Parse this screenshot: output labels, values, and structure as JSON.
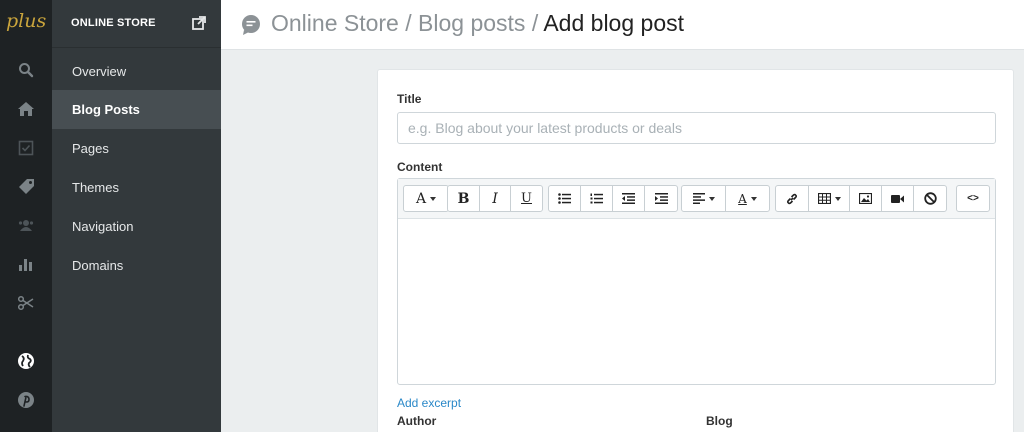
{
  "app": {
    "logo_text": "plus",
    "brand_color": "#c9a43c"
  },
  "rail": {
    "icons": [
      "search-icon",
      "home-icon",
      "orders-icon",
      "tag-icon",
      "customers-icon",
      "reports-icon",
      "discounts-icon",
      "globe-icon",
      "pinterest-icon"
    ]
  },
  "subnav": {
    "title": "ONLINE STORE",
    "items": [
      {
        "label": "Overview",
        "active": false
      },
      {
        "label": "Blog Posts",
        "active": true
      },
      {
        "label": "Pages",
        "active": false
      },
      {
        "label": "Themes",
        "active": false
      },
      {
        "label": "Navigation",
        "active": false
      },
      {
        "label": "Domains",
        "active": false
      }
    ]
  },
  "breadcrumb": {
    "part1": "Online Store",
    "sep1": " / ",
    "part2": "Blog posts",
    "sep2": " / ",
    "current": "Add blog post"
  },
  "form": {
    "title_label": "Title",
    "title_value": "",
    "title_placeholder": "e.g. Blog about your latest products or deals",
    "content_label": "Content",
    "toolbar": {
      "font_glyph": "A",
      "bold_glyph": "B",
      "italic_glyph": "I",
      "underline_glyph": "U",
      "color_glyph": "A",
      "code_glyph": "<>"
    },
    "add_excerpt": "Add excerpt",
    "author_label": "Author",
    "blog_label": "Blog"
  },
  "colors": {
    "link": "#2a88c8",
    "sidebar_dark": "#1e2224",
    "sidebar_sub": "#33393c",
    "active_item": "#474e52"
  }
}
